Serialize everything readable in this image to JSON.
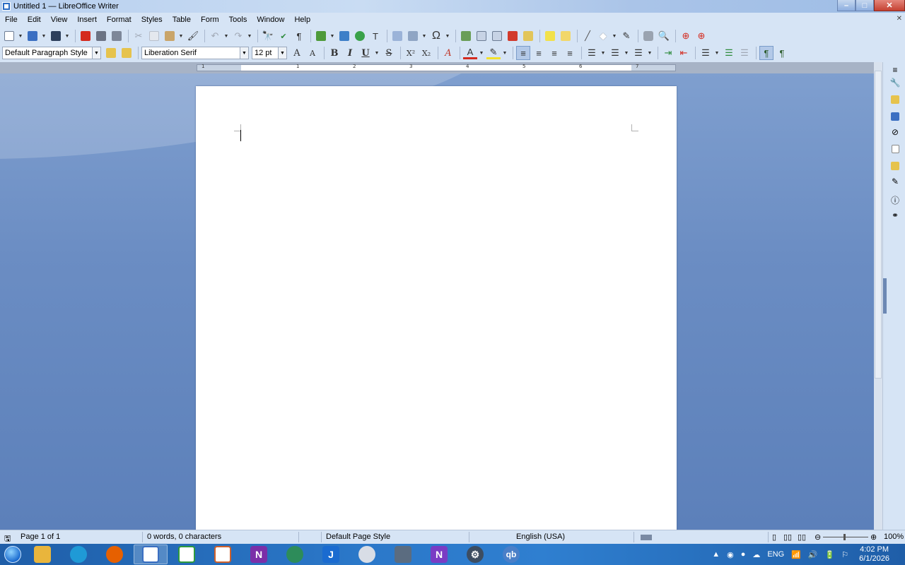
{
  "window": {
    "title": "Untitled 1 — LibreOffice Writer",
    "controls": {
      "minimize": "–",
      "maximize": "□",
      "close": "✕"
    }
  },
  "menubar": {
    "items": [
      "File",
      "Edit",
      "View",
      "Insert",
      "Format",
      "Styles",
      "Table",
      "Form",
      "Tools",
      "Window",
      "Help"
    ],
    "close_glyph": "✕"
  },
  "formatting": {
    "paragraph_style": "Default Paragraph Style",
    "font_name": "Liberation Serif",
    "font_size": "12 pt",
    "bold": "B",
    "italic": "I",
    "underline": "U",
    "strikethrough": "S",
    "superscript": "X²",
    "subscript": "X₂"
  },
  "ruler": {
    "numbers": [
      "1",
      "1",
      "2",
      "3",
      "4",
      "5",
      "6",
      "7"
    ]
  },
  "statusbar": {
    "page": "Page 1 of 1",
    "words": "0 words, 0 characters",
    "page_style": "Default Page Style",
    "language": "English (USA)",
    "zoom": "100%"
  },
  "taskbar": {
    "apps": [
      {
        "name": "file-explorer",
        "color": "#e9b53c"
      },
      {
        "name": "edge",
        "color": "#1f9ad6"
      },
      {
        "name": "firefox",
        "color": "#e66000"
      },
      {
        "name": "writer",
        "color": "#3b6fc2"
      },
      {
        "name": "calc",
        "color": "#2e9a3d"
      },
      {
        "name": "impress",
        "color": "#d0612b"
      },
      {
        "name": "onenote",
        "color": "#7b2fa8"
      },
      {
        "name": "globe",
        "color": "#2d8c5a"
      },
      {
        "name": "joplin",
        "color": "#1a6bd0"
      },
      {
        "name": "sphere",
        "color": "#d8dde6"
      },
      {
        "name": "calculator",
        "color": "#5b6c80"
      },
      {
        "name": "notion-n",
        "color": "#7a3cc4"
      },
      {
        "name": "settings",
        "color": "#3d4d61"
      },
      {
        "name": "qbittorrent",
        "color": "#4a7fc8"
      }
    ],
    "joplin_glyph": "J",
    "onenote_glyph": "N",
    "notion_glyph": "N",
    "qbittorrent_glyph": "qb",
    "tray": {
      "language": "ENG",
      "time": "4:02 PM",
      "date": "6/1/2026"
    }
  }
}
